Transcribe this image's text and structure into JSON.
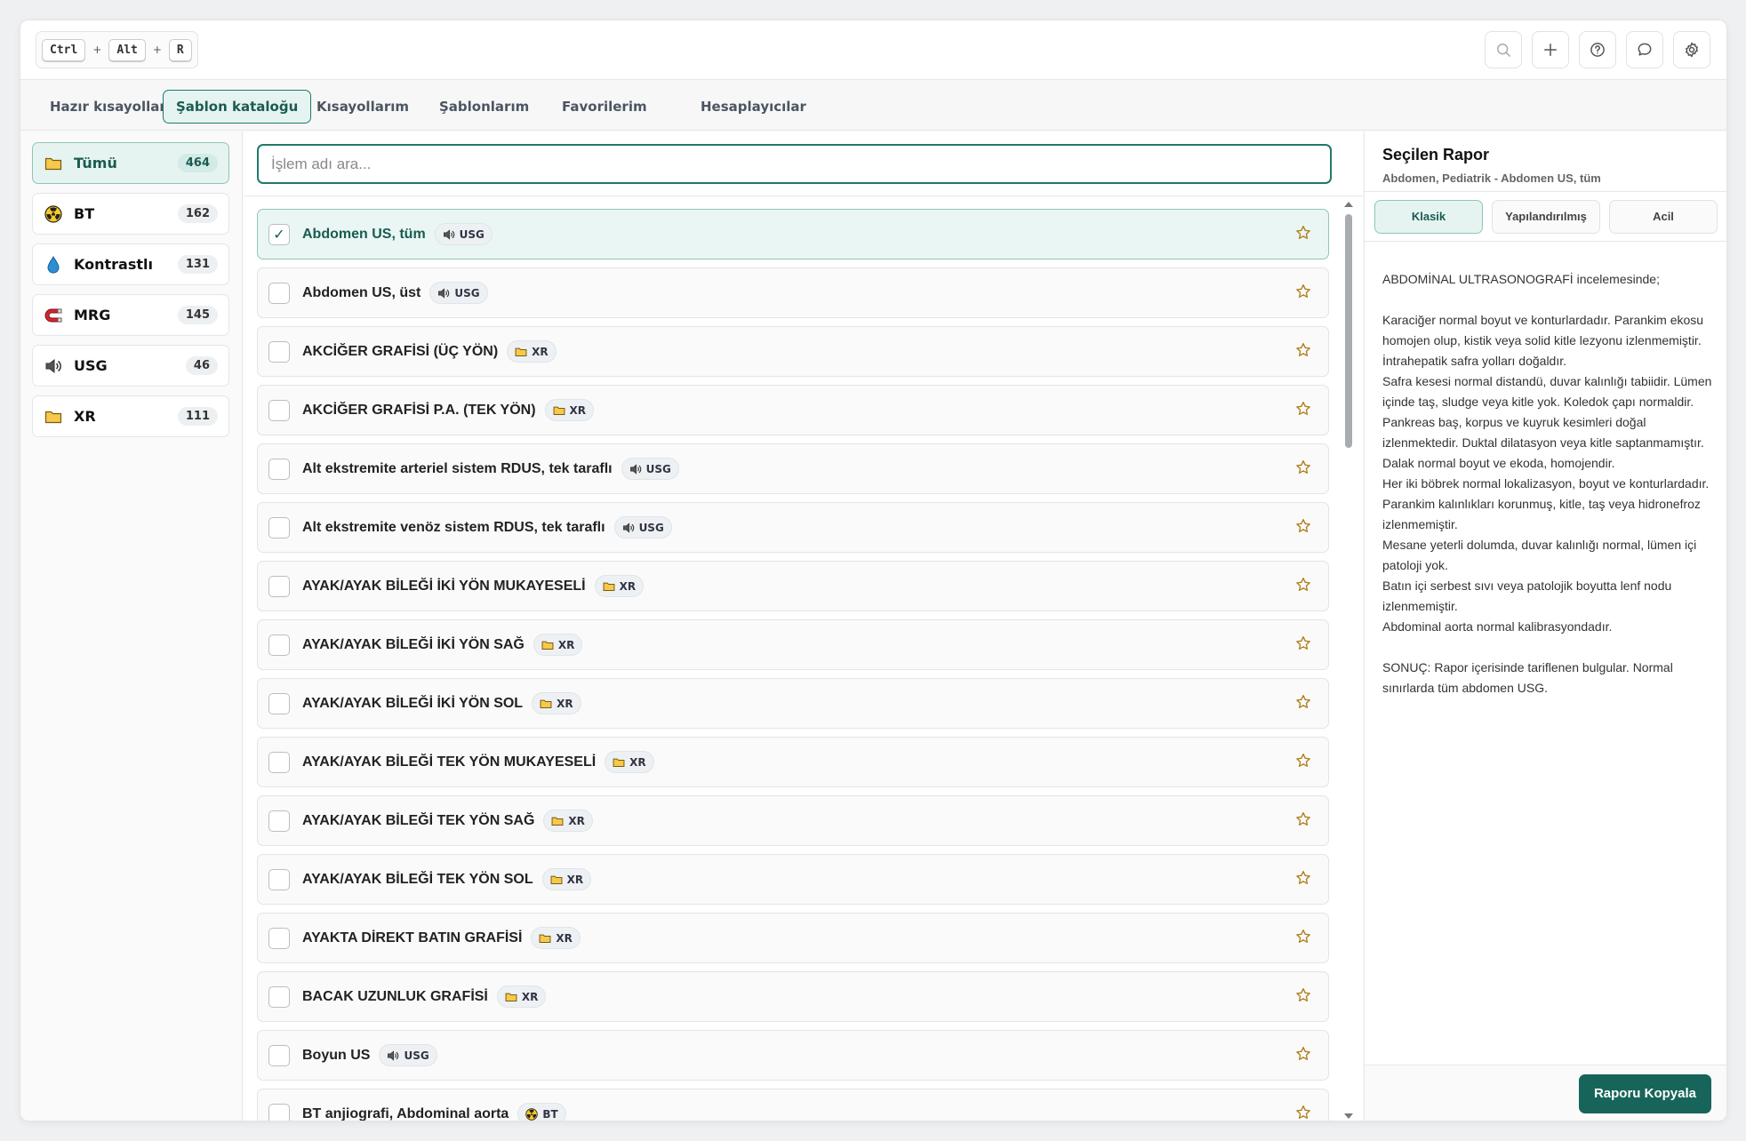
{
  "shortcut": {
    "keys": [
      "Ctrl",
      "Alt",
      "R"
    ],
    "separator": "+"
  },
  "header_icons": [
    "search-icon",
    "plus-icon",
    "help-icon",
    "chat-icon",
    "gear-icon"
  ],
  "tabs": [
    {
      "label": "Hazır kısayollar",
      "active": false
    },
    {
      "label": "Şablon kataloğu",
      "active": true
    },
    {
      "label": "Kısayollarım",
      "active": false
    },
    {
      "label": "Şablonlarım",
      "active": false
    },
    {
      "label": "Favorilerim",
      "active": false
    },
    {
      "label": "Hesaplayıcılar",
      "active": false
    }
  ],
  "categories": [
    {
      "label": "Tümü",
      "count": "464",
      "icon": "folder-icon",
      "active": true
    },
    {
      "label": "BT",
      "count": "162",
      "icon": "radiation-icon",
      "active": false
    },
    {
      "label": "Kontrastlı",
      "count": "131",
      "icon": "drop-icon",
      "active": false
    },
    {
      "label": "MRG",
      "count": "145",
      "icon": "magnet-icon",
      "active": false
    },
    {
      "label": "USG",
      "count": "46",
      "icon": "speaker-icon",
      "active": false
    },
    {
      "label": "XR",
      "count": "111",
      "icon": "folder-icon",
      "active": false
    }
  ],
  "search": {
    "placeholder": "İşlem adı ara...",
    "value": ""
  },
  "procedures": [
    {
      "name": "Abdomen US, tüm",
      "modality": "USG",
      "checked": true
    },
    {
      "name": "Abdomen US, üst",
      "modality": "USG",
      "checked": false
    },
    {
      "name": "AKCİĞER GRAFİSİ (ÜÇ YÖN)",
      "modality": "XR",
      "checked": false
    },
    {
      "name": "AKCİĞER GRAFİSİ P.A. (TEK YÖN)",
      "modality": "XR",
      "checked": false
    },
    {
      "name": "Alt ekstremite arteriel sistem RDUS, tek taraflı",
      "modality": "USG",
      "checked": false
    },
    {
      "name": "Alt ekstremite venöz sistem RDUS, tek taraflı",
      "modality": "USG",
      "checked": false
    },
    {
      "name": "AYAK/AYAK BİLEĞİ İKİ YÖN MUKAYESELİ",
      "modality": "XR",
      "checked": false
    },
    {
      "name": "AYAK/AYAK BİLEĞİ İKİ YÖN SAĞ",
      "modality": "XR",
      "checked": false
    },
    {
      "name": "AYAK/AYAK BİLEĞİ İKİ YÖN SOL",
      "modality": "XR",
      "checked": false
    },
    {
      "name": "AYAK/AYAK BİLEĞİ TEK YÖN MUKAYESELİ",
      "modality": "XR",
      "checked": false
    },
    {
      "name": "AYAK/AYAK BİLEĞİ TEK YÖN SAĞ",
      "modality": "XR",
      "checked": false
    },
    {
      "name": "AYAK/AYAK BİLEĞİ TEK YÖN SOL",
      "modality": "XR",
      "checked": false
    },
    {
      "name": "AYAKTA DİREKT BATIN GRAFİSİ",
      "modality": "XR",
      "checked": false
    },
    {
      "name": "BACAK UZUNLUK GRAFİSİ",
      "modality": "XR",
      "checked": false
    },
    {
      "name": "Boyun US",
      "modality": "USG",
      "checked": false
    },
    {
      "name": "BT anjiografi, Abdominal aorta",
      "modality": "BT",
      "checked": false
    }
  ],
  "panel": {
    "title": "Seçilen Rapor",
    "subtitle": "Abdomen, Pediatrik - Abdomen US, tüm",
    "modes": [
      {
        "label": "Klasik",
        "active": true
      },
      {
        "label": "Yapılandırılmış",
        "active": false
      },
      {
        "label": "Acil",
        "active": false
      }
    ],
    "report_lines": [
      "ABDOMİNAL ULTRASONOGRAFİ incelemesinde;",
      "",
      "Karaciğer normal boyut ve konturlardadır. Parankim ekosu homojen olup, kistik veya solid kitle lezyonu izlenmemiştir. İntrahepatik safra yolları doğaldır.",
      "Safra kesesi normal distandü, duvar kalınlığı tabiidir. Lümen içinde taş, sludge veya kitle yok. Koledok çapı normaldir.",
      "Pankreas baş, korpus ve kuyruk kesimleri doğal izlenmektedir. Duktal dilatasyon veya kitle saptanmamıştır.",
      "Dalak normal boyut ve ekoda, homojendir.",
      "Her iki böbrek normal lokalizasyon, boyut ve konturlardadır. Parankim kalınlıkları korunmuş, kitle, taş veya hidronefroz izlenmemiştir.",
      "Mesane yeterli dolumda, duvar kalınlığı normal, lümen içi patoloji yok.",
      "Batın içi serbest sıvı veya patolojik boyutta lenf nodu izlenmemiştir.",
      "Abdominal aorta normal kalibrasyondadır.",
      "",
      "SONUÇ: Rapor içerisinde tariflenen bulgular. Normal sınırlarda tüm abdomen USG."
    ],
    "copy_label": "Raporu Kopyala"
  },
  "colors": {
    "accent": "#1f7a6b",
    "accent_light": "#e6f4f1",
    "button": "#17655a",
    "star": "#b07d1a"
  }
}
